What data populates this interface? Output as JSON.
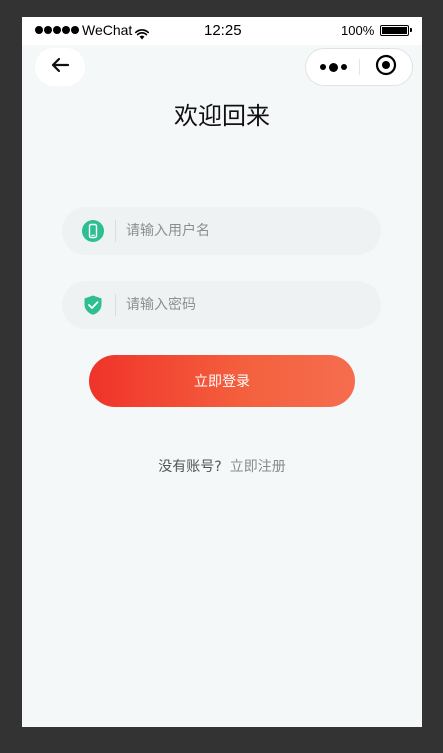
{
  "status_bar": {
    "carrier": "WeChat",
    "time": "12:25",
    "battery_percent": "100%",
    "battery_level": 1.0
  },
  "nav": {
    "back_icon": "arrow-left-icon",
    "more_icon": "more-dots-icon",
    "close_icon": "target-close-icon"
  },
  "page": {
    "title": "欢迎回来"
  },
  "form": {
    "username": {
      "placeholder": "请输入用户名",
      "value": "",
      "icon": "phone-icon"
    },
    "password": {
      "placeholder": "请输入密码",
      "value": "",
      "icon": "shield-check-icon"
    },
    "login_label": "立即登录"
  },
  "register": {
    "question": "没有账号?",
    "link": "立即注册"
  },
  "colors": {
    "background": "#F5F8F9",
    "accent_start": "#F0332A",
    "accent_end": "#F56D4E",
    "icon_green": "#2DBE91"
  }
}
